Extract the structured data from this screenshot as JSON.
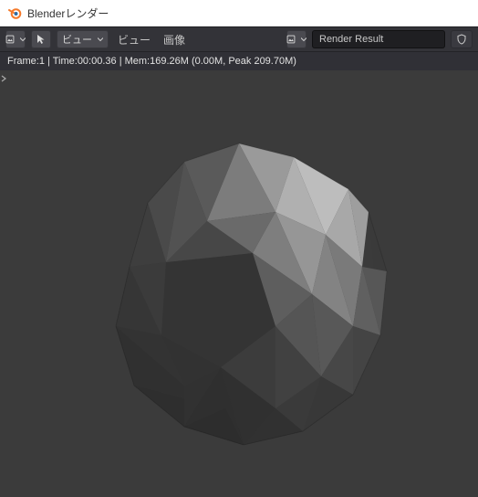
{
  "window": {
    "title": "Blenderレンダー"
  },
  "toolbar": {
    "view_dropdown": "ビュー",
    "menu_view": "ビュー",
    "menu_image": "画像",
    "slot_label": "Render Result"
  },
  "status": {
    "text": "Frame:1 | Time:00:00.36 | Mem:169.26M (0.00M, Peak 209.70M)"
  }
}
